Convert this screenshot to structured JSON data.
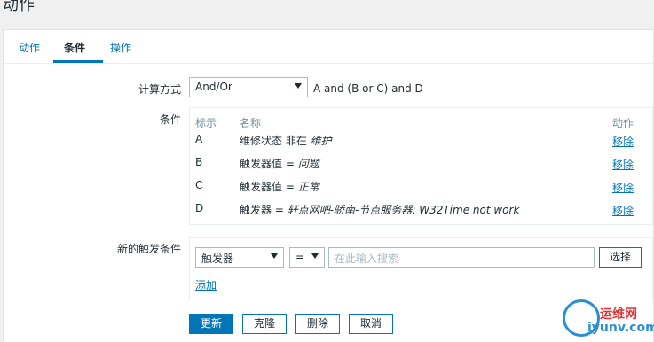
{
  "page": {
    "title": "动作"
  },
  "tabs": [
    {
      "label": "动作"
    },
    {
      "label": "条件"
    },
    {
      "label": "操作"
    }
  ],
  "calc": {
    "label": "计算方式",
    "selected": "And/Or",
    "expression": "A and (B or C) and D"
  },
  "conditions": {
    "label": "条件",
    "headers": {
      "tag": "标示",
      "name": "名称",
      "action": "动作"
    },
    "rows": [
      {
        "tag": "A",
        "name": "维修状态 非在 ",
        "name_em": "维护",
        "remove": "移除"
      },
      {
        "tag": "B",
        "name": "触发器值 = ",
        "name_em": "问题",
        "remove": "移除"
      },
      {
        "tag": "C",
        "name": "触发器值 = ",
        "name_em": "正常",
        "remove": "移除"
      },
      {
        "tag": "D",
        "name": "触发器 = ",
        "name_em": "轩点网吧-骄南-节点服务器: W32Time not work",
        "remove": "移除"
      }
    ]
  },
  "new_condition": {
    "label": "新的触发条件",
    "type_selected": "触发器",
    "operator_selected": "=",
    "search_placeholder": "在此输入搜索",
    "select_button": "选择",
    "add_link": "添加"
  },
  "buttons": {
    "update": "更新",
    "clone": "克隆",
    "delete": "删除",
    "cancel": "取消"
  },
  "watermark": {
    "line1": "运维网",
    "line2": "iyunv.com"
  }
}
